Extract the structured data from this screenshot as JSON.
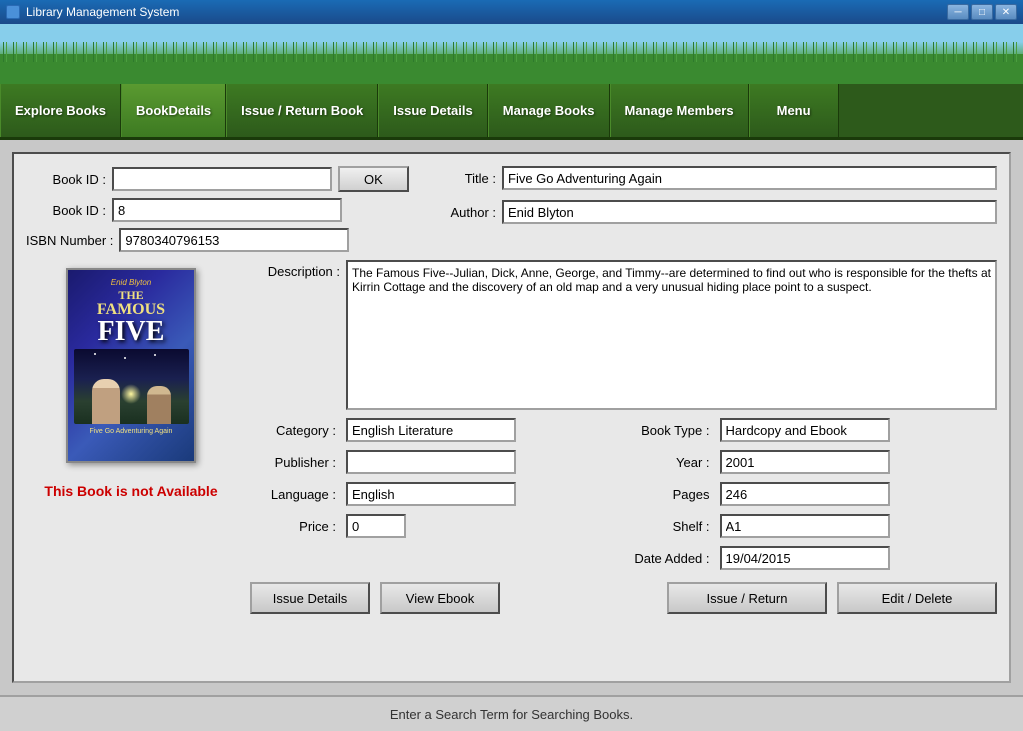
{
  "titlebar": {
    "title": "Library Management System",
    "minimize": "─",
    "maximize": "□",
    "close": "✕"
  },
  "nav": {
    "items": [
      {
        "id": "explore-books",
        "label": "Explore Books",
        "active": false
      },
      {
        "id": "book-details",
        "label": "BookDetails",
        "active": true
      },
      {
        "id": "issue-return",
        "label": "Issue / Return Book",
        "active": false
      },
      {
        "id": "issue-details",
        "label": "Issue Details",
        "active": false
      },
      {
        "id": "manage-books",
        "label": "Manage Books",
        "active": false
      },
      {
        "id": "manage-members",
        "label": "Manage Members",
        "active": false
      },
      {
        "id": "menu",
        "label": "Menu",
        "active": false
      }
    ]
  },
  "form": {
    "book_id_label": "Book ID :",
    "book_id_value": "",
    "book_id_label2": "Book ID :",
    "book_id_value2": "8",
    "isbn_label": "ISBN Number :",
    "isbn_value": "9780340796153",
    "ok_button": "OK",
    "title_label": "Title :",
    "title_value": "Five Go Adventuring Again",
    "author_label": "Author :",
    "author_value": "Enid Blyton",
    "description_label": "Description :",
    "description_value": "The Famous Five--Julian, Dick, Anne, George, and Timmy--are determined to find out who is responsible for the thefts at Kirrin Cottage and the discovery of an old map and a very unusual hiding place point to a suspect.",
    "category_label": "Category :",
    "category_value": "English Literature",
    "book_type_label": "Book Type :",
    "book_type_value": "Hardcopy and Ebook",
    "publisher_label": "Publisher :",
    "publisher_value": "",
    "year_label": "Year :",
    "year_value": "2001",
    "language_label": "Language :",
    "language_value": "English",
    "pages_label": "Pages",
    "pages_value": "246",
    "price_label": "Price :",
    "price_value": "0",
    "shelf_label": "Shelf :",
    "shelf_value": "A1",
    "date_added_label": "Date Added :",
    "date_added_value": "19/04/2015",
    "unavailable_text": "This Book is not Available",
    "cover_author": "Enid Blyton",
    "cover_title_famous": "THE FAMOUS",
    "cover_title_five": "FIVE",
    "cover_subtitle": "Five Go Adventuring Again"
  },
  "buttons": {
    "issue_details": "Issue Details",
    "view_ebook": "View Ebook",
    "issue_return": "Issue / Return",
    "edit_delete": "Edit / Delete"
  },
  "statusbar": {
    "text": "Enter a Search Term for Searching Books."
  }
}
